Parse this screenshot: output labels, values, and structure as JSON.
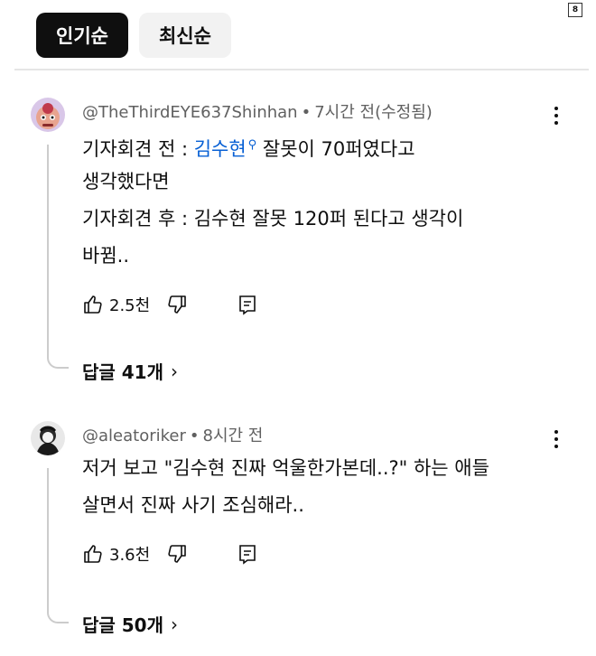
{
  "badge": "8",
  "sort_chips": [
    {
      "label": "인기순",
      "active": true
    },
    {
      "label": "최신순",
      "active": false
    }
  ],
  "comments": [
    {
      "author": "@TheThirdEYE637Shinhan",
      "time": "7시간 전(수정됨)",
      "lines": [
        {
          "pre": "기자회견 전 : ",
          "mention": "김수현",
          "post": " 잘못이 70퍼였다고"
        },
        {
          "text": "생각했다면"
        },
        {
          "text": "기자회견 후 : 김수현 잘못 120퍼 된다고 생각이"
        },
        {
          "text": "바뀜.."
        }
      ],
      "likes": "2.5천",
      "replies": "답글 41개"
    },
    {
      "author": "@aleatoriker",
      "time": "8시간 전",
      "lines": [
        {
          "text": "저거 보고 \"김수현 진짜 억울한가본데..?\" 하는 애들"
        },
        {
          "text": "살면서 진짜 사기 조심해라.."
        }
      ],
      "likes": "3.6천",
      "replies": "답글 50개"
    }
  ],
  "icons": {
    "like": "thumbs-up-icon",
    "dislike": "thumbs-down-icon",
    "reply": "reply-icon",
    "more": "more-vert-icon",
    "chevron": "chevron-right-icon"
  },
  "colors": {
    "text": "#0f0f0f",
    "meta": "#606060",
    "mention": "#065fd4",
    "chip_active_bg": "#0f0f0f",
    "chip_inactive_bg": "#f2f2f2"
  }
}
